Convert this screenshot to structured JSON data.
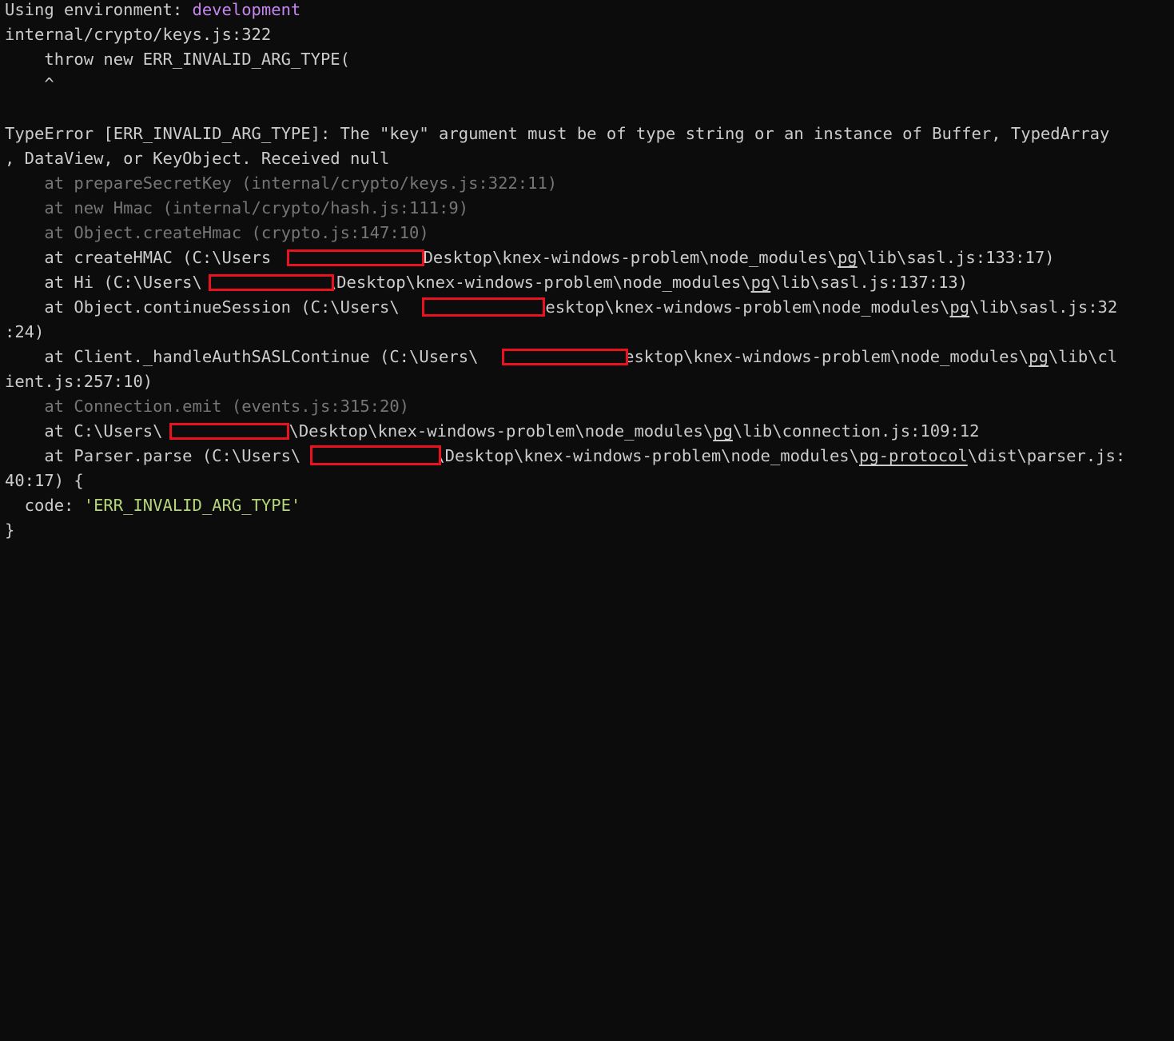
{
  "env": {
    "prefix": "Using environment: ",
    "value": "development"
  },
  "lines": {
    "l1": "internal/crypto/keys.js:322",
    "l2": "    throw new ERR_INVALID_ARG_TYPE(",
    "l3": "    ^",
    "l5": "TypeError [ERR_INVALID_ARG_TYPE]: The \"key\" argument must be of type string or an instance of Buffer, TypedArray",
    "l6": ", DataView, or KeyObject. Received null",
    "l7": "    at prepareSecretKey (internal/crypto/keys.js:322:11)",
    "l8": "    at new Hmac (internal/crypto/hash.js:111:9)",
    "l9": "    at Object.createHmac (crypto.js:147:10)",
    "l10a": "    at createHMAC (C:\\Users",
    "l10b": "\\Desktop\\knex-windows-problem\\node_modules\\",
    "l10c": "pg",
    "l10d": "\\lib\\sasl.js:133:17)",
    "l11a": "    at Hi (C:\\Users\\",
    "l11b": "\\Desktop\\knex-windows-problem\\node_modules\\",
    "l11c": "pg",
    "l11d": "\\lib\\sasl.js:137:13)",
    "l12a": "    at Object.continueSession (C:\\Users\\",
    "l12b": "\\Desktop\\knex-windows-problem\\node_modules\\",
    "l12c": "pg",
    "l12d": "\\lib\\sasl.js:32",
    "l13": ":24)",
    "l14a": "    at Client._handleAuthSASLContinue (C:\\Users\\",
    "l14b": "\\Desktop\\knex-windows-problem\\node_modules\\",
    "l14c": "pg",
    "l14d": "\\lib\\cl",
    "l15": "ient.js:257:10)",
    "l16": "    at Connection.emit (events.js:315:20)",
    "l17a": "    at C:\\Users\\",
    "l17b": "\\Desktop\\knex-windows-problem\\node_modules\\",
    "l17c": "pg",
    "l17d": "\\lib\\connection.js:109:12",
    "l18a": "    at Parser.parse (C:\\Users\\",
    "l18b": "\\Desktop\\knex-windows-problem\\node_modules\\",
    "l18c": "pg-protocol",
    "l18d": "\\dist\\parser.js:",
    "l19": "40:17) {",
    "l20a": "  code: ",
    "l20b": "'ERR_INVALID_ARG_TYPE'",
    "l21": "}"
  },
  "colors": {
    "background": "#0c0c0c",
    "text": "#cccccc",
    "dim": "#767676",
    "accent_purple": "#c586f0",
    "string_green": "#b5d67a",
    "redaction_red": "#e8131f"
  }
}
